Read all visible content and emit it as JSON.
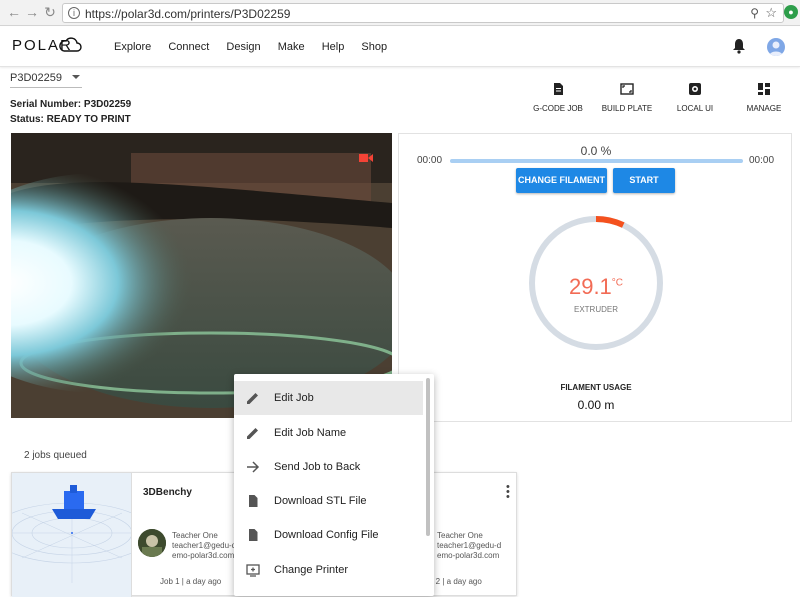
{
  "browser": {
    "url": "https://polar3d.com/printers/P3D02259"
  },
  "nav": {
    "logo": "POLAR",
    "links": [
      "Explore",
      "Connect",
      "Design",
      "Make",
      "Help",
      "Shop"
    ]
  },
  "printer": {
    "selected": "P3D02259",
    "serial_text": "Serial Number: P3D02259",
    "status_text": "Status: READY TO PRINT"
  },
  "actions": [
    "G-CODE JOB",
    "BUILD PLATE",
    "LOCAL UI",
    "MANAGE"
  ],
  "progress": {
    "percent_label": "0.0 %",
    "percent": 0,
    "elapsed": "00:00",
    "remaining": "00:00",
    "change_filament": "CHANGE FILAMENT",
    "start": "START"
  },
  "extruder": {
    "temp": "29.1",
    "unit": "°C",
    "label": "EXTRUDER",
    "fraction": 0.07,
    "accent": "#f4511e"
  },
  "filament": {
    "label": "FILAMENT USAGE",
    "value": "0.00 m"
  },
  "queue": {
    "count_text": "2 jobs queued",
    "jobs": [
      {
        "name": "3DBenchy",
        "owner": "Teacher One",
        "email1": "teacher1@gedu-d",
        "email2": "emo-polar3d.com",
        "meta": "Job 1 | a day ago"
      },
      {
        "name": "",
        "owner": "Teacher One",
        "email1": "teacher1@gedu-d",
        "email2": "emo-polar3d.com",
        "meta": "b 2 | a day ago"
      }
    ]
  },
  "context_menu": [
    {
      "label": "Edit Job",
      "icon": "pencil-icon"
    },
    {
      "label": "Edit Job Name",
      "icon": "pencil-icon"
    },
    {
      "label": "Send Job to Back",
      "icon": "arrow-right-icon"
    },
    {
      "label": "Download STL File",
      "icon": "file-icon"
    },
    {
      "label": "Download Config File",
      "icon": "file-icon"
    },
    {
      "label": "Change Printer",
      "icon": "monitor-plus-icon"
    }
  ],
  "colors": {
    "primary": "#1e88e5",
    "temp": "#f26b55",
    "progress_track": "#a9cff3"
  }
}
